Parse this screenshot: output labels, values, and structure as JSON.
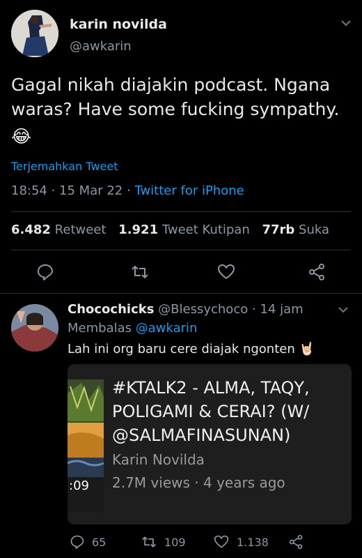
{
  "main_tweet": {
    "name": "karin novilda",
    "handle": "@awkarin",
    "text": "Gagal nikah diajakin podcast. Ngana waras? Have some fucking sympathy.",
    "emoji": "😂",
    "translate": "Terjemahkan Tweet",
    "time": "18:54",
    "date": "15 Mar 22",
    "source": "Twitter for iPhone",
    "retweets_count": "6.482",
    "retweets_label": "Retweet",
    "quotes_count": "1.921",
    "quotes_label": "Tweet Kutipan",
    "likes_count": "77rb",
    "likes_label": "Suka"
  },
  "reply": {
    "name": "Chocochicks",
    "handle": "@Blessychoco",
    "time": "14 jam",
    "replying_label": "Membalas",
    "replying_to": "@awkarin",
    "text": "Lah ini org baru cere diajak ngonten 🤘🏻",
    "card": {
      "title": "#KTALK2 - ALMA, TAQY, POLIGAMI & CERAI? (W/ @SALMAFINASUNAN)",
      "channel": "Karin Novilda",
      "views": "2.7M views",
      "age": "4 years ago",
      "duration_fragment": ":09"
    },
    "replies_count": "65",
    "retweets_count": "109",
    "likes_count": "1.138"
  },
  "icons": {
    "reply": "reply-icon",
    "retweet": "retweet-icon",
    "like": "heart-icon",
    "share": "share-icon",
    "chevron": "chevron-down-icon"
  },
  "colors": {
    "background": "#000000",
    "text": "#e7e9ea",
    "muted": "#8b98a5",
    "link": "#1d9bf0",
    "divider": "#2f3336",
    "card": "#1e1e1e"
  }
}
